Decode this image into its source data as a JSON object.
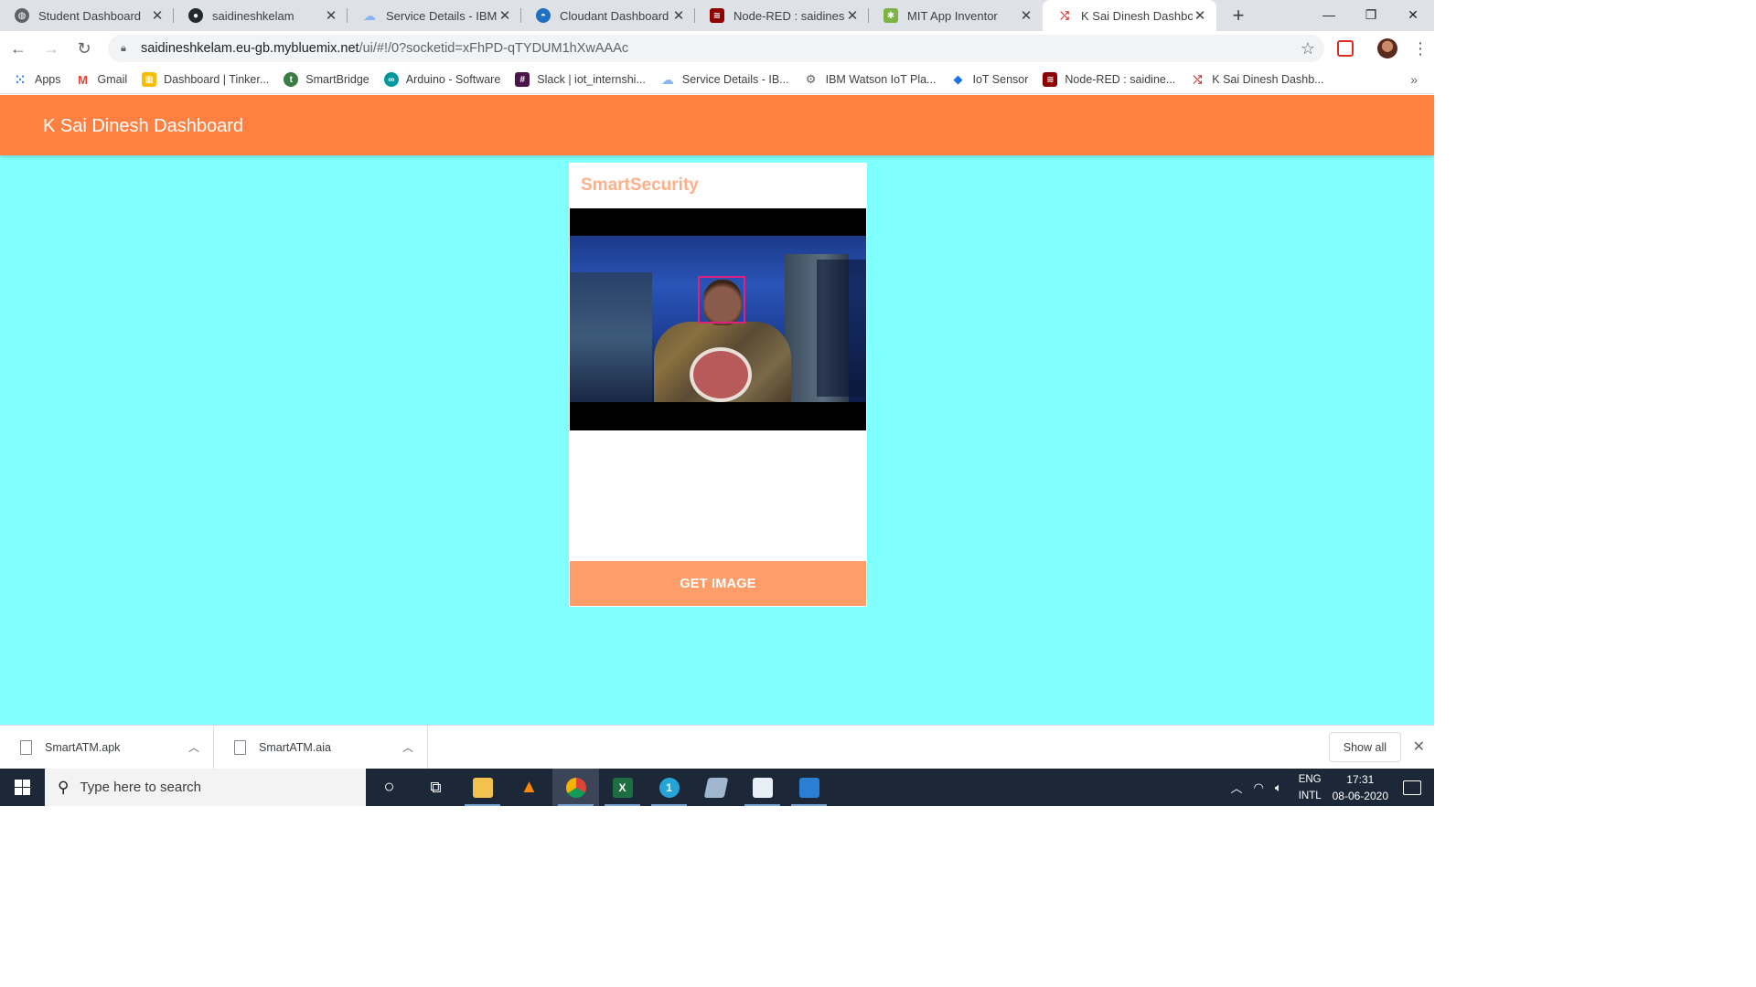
{
  "browser": {
    "tabs": [
      {
        "title": "Student Dashboard",
        "icon": "globe-icon",
        "color": "#5f6368"
      },
      {
        "title": "saidineshkelam",
        "icon": "github-icon",
        "color": "#24292e"
      },
      {
        "title": "Service Details - IBM Cl",
        "icon": "cloud-icon",
        "color": "#8ab4f8"
      },
      {
        "title": "Cloudant Dashboard -",
        "icon": "cloudant-icon",
        "color": "#1f70c1"
      },
      {
        "title": "Node-RED : saidineshke",
        "icon": "node-red-icon",
        "color": "#8f0000"
      },
      {
        "title": "MIT App Inventor",
        "icon": "app-inventor-icon",
        "color": "#7cb342"
      },
      {
        "title": "K Sai Dinesh Dashboard",
        "icon": "node-red-flow-icon",
        "color": "#d32f2f"
      }
    ],
    "active_tab": 6,
    "new_tab": "+",
    "window_controls": {
      "minimize": "—",
      "maximize": "❐",
      "close": "✕"
    },
    "url_host": "saidineshkelam.eu-gb.mybluemix.net",
    "url_path": "/ui/#!/0?socketid=xFhPD-qTYDUM1hXwAAAc",
    "bookmarks": [
      {
        "label": "Apps",
        "icon": "apps-grid-icon",
        "color": "#4285f4"
      },
      {
        "label": "Gmail",
        "icon": "gmail-icon",
        "color": "#ea4335"
      },
      {
        "label": "Dashboard | Tinker...",
        "icon": "tinkercad-icon",
        "color": "#fbbc05"
      },
      {
        "label": "SmartBridge",
        "icon": "smartbridge-icon",
        "color": "#3a7d44"
      },
      {
        "label": "Arduino - Software",
        "icon": "arduino-icon",
        "color": "#00979d"
      },
      {
        "label": "Slack | iot_internshi...",
        "icon": "slack-icon",
        "color": "#4a154b"
      },
      {
        "label": "Service Details - IB...",
        "icon": "cloud-icon",
        "color": "#8ab4f8"
      },
      {
        "label": "IBM Watson IoT Pla...",
        "icon": "watson-iot-icon",
        "color": "#5f6368"
      },
      {
        "label": "IoT Sensor",
        "icon": "iot-sensor-icon",
        "color": "#1a73e8"
      },
      {
        "label": "Node-RED : saidine...",
        "icon": "node-red-icon",
        "color": "#8f0000"
      },
      {
        "label": "K Sai Dinesh Dashb...",
        "icon": "node-red-flow-icon",
        "color": "#d32f2f"
      }
    ],
    "more_bookmarks": "»"
  },
  "app": {
    "header_title": "K Sai Dinesh Dashboard",
    "header_color": "#ff8040",
    "background_color": "#80ffff",
    "card_title": "SmartSecurity",
    "button_label": "GET IMAGE"
  },
  "downloads": {
    "items": [
      {
        "name": "SmartATM.apk"
      },
      {
        "name": "SmartATM.aia"
      }
    ],
    "show_all": "Show all",
    "close": "✕"
  },
  "taskbar": {
    "search_placeholder": "Type here to search",
    "apps": [
      {
        "name": "cortana-icon",
        "glyph": "○"
      },
      {
        "name": "task-view-icon",
        "glyph": "⧉"
      },
      {
        "name": "file-explorer-icon",
        "glyph": ""
      },
      {
        "name": "vlc-icon",
        "glyph": "▲"
      },
      {
        "name": "chrome-icon",
        "glyph": ""
      },
      {
        "name": "excel-icon",
        "glyph": "X"
      },
      {
        "name": "whatsapp-icon",
        "glyph": "1"
      },
      {
        "name": "notepad-icon",
        "glyph": ""
      },
      {
        "name": "python-icon",
        "glyph": ""
      },
      {
        "name": "photos-icon",
        "glyph": ""
      }
    ],
    "tray": {
      "lang_top": "ENG",
      "lang_bottom": "INTL",
      "time": "17:31",
      "date": "08-06-2020"
    }
  }
}
